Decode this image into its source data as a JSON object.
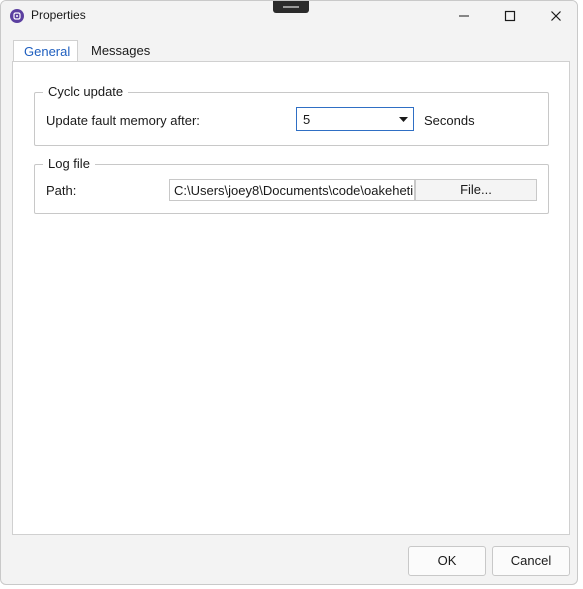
{
  "window": {
    "title": "Properties",
    "controls": {
      "minimize": "minimize-icon",
      "maximize": "maximize-icon",
      "close": "close-icon"
    }
  },
  "tabs": [
    {
      "label": "General",
      "active": true
    },
    {
      "label": "Messages",
      "active": false
    }
  ],
  "cycle_group": {
    "legend": "Cyclc update",
    "field_label": "Update fault memory after:",
    "select_value": "5",
    "unit": "Seconds"
  },
  "log_group": {
    "legend": "Log file",
    "path_label": "Path:",
    "path_value": "C:\\Users\\joey8\\Documents\\code\\oakeheti",
    "file_button": "File..."
  },
  "footer": {
    "ok": "OK",
    "cancel": "Cancel"
  },
  "colors": {
    "accent": "#2f6fc4",
    "active_tab_text": "#1f5fbf",
    "app_icon": "#5b3fa0"
  }
}
